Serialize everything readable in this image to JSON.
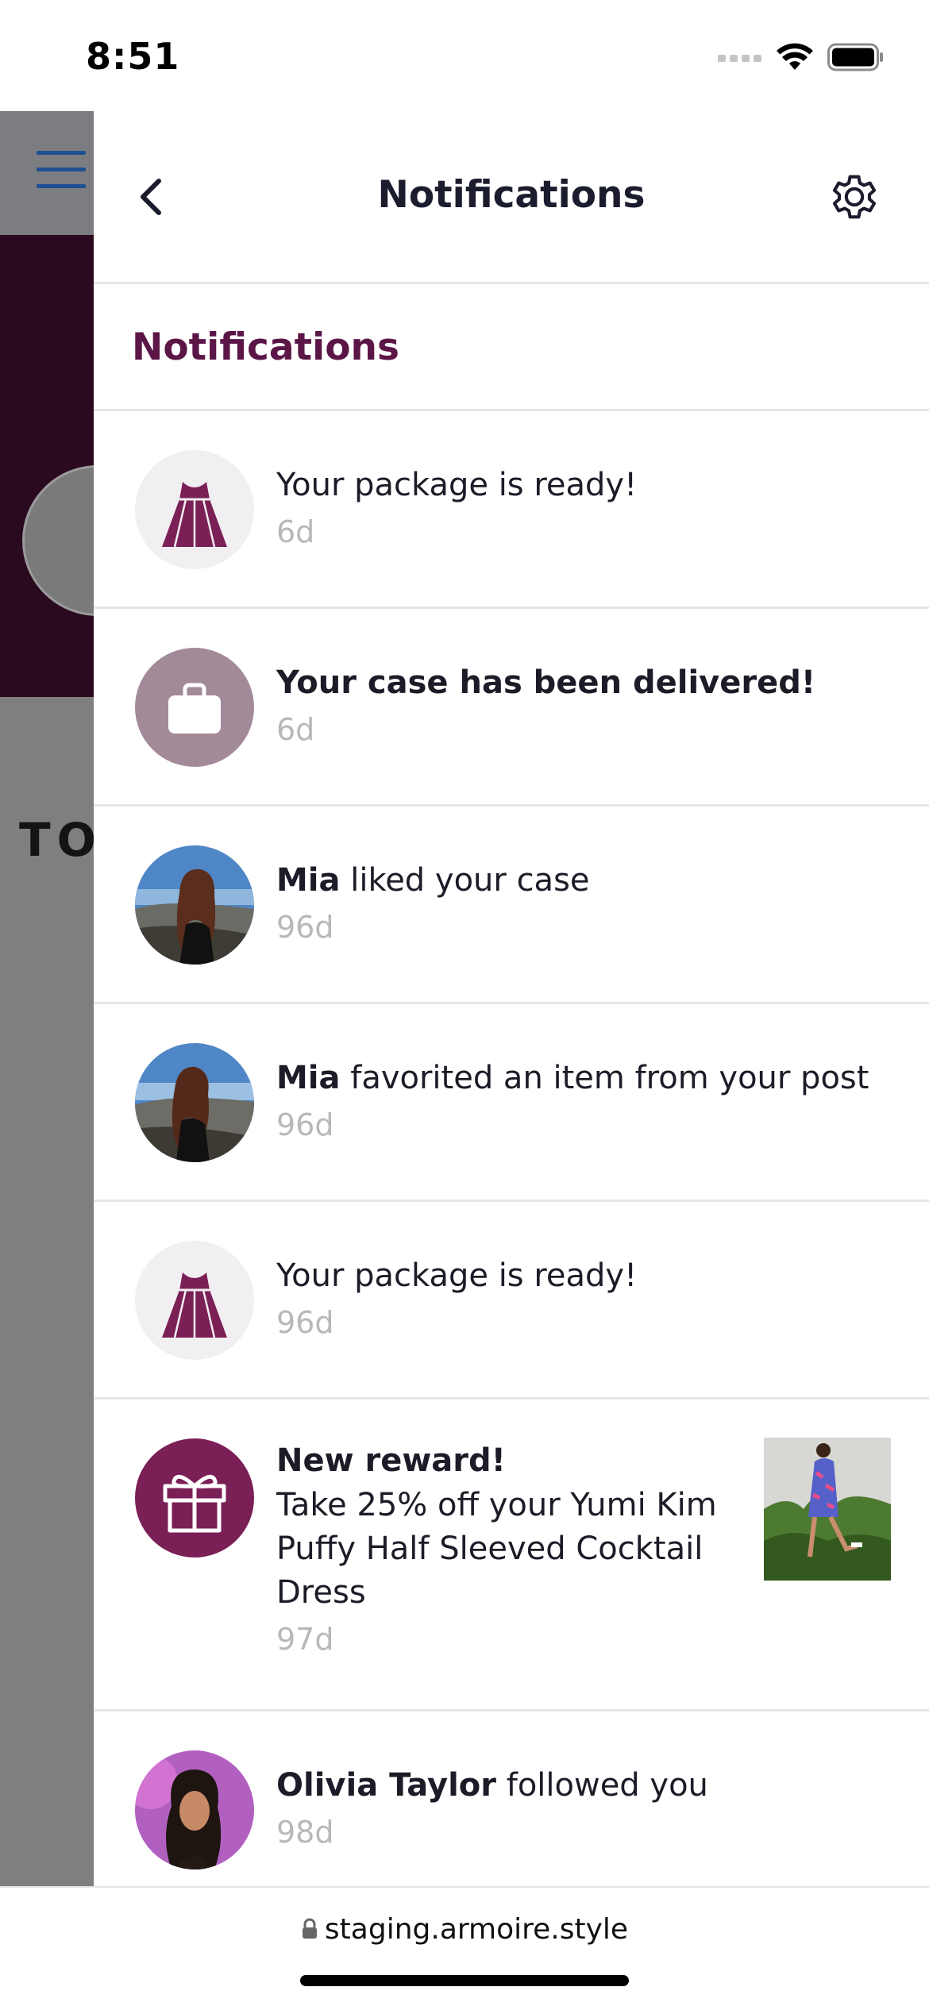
{
  "status_bar": {
    "time": "8:51"
  },
  "background_app": {
    "partial_text": "TO"
  },
  "header": {
    "title": "Notifications"
  },
  "section": {
    "title": "Notifications"
  },
  "notifications": [
    {
      "icon": "dress-icon",
      "actor": "",
      "text": "Your package is ready!",
      "time": "6d",
      "bold": false
    },
    {
      "icon": "briefcase-icon",
      "actor": "",
      "text": "Your case has been delivered!",
      "time": "6d",
      "bold": true
    },
    {
      "icon": "user-photo",
      "actor": "Mia",
      "text": " liked your case",
      "time": "96d"
    },
    {
      "icon": "user-photo",
      "actor": "Mia",
      "text": " favorited an item from your post",
      "time": "96d"
    },
    {
      "icon": "dress-icon",
      "actor": "",
      "text": "Your package is ready!",
      "time": "96d",
      "bold": false
    },
    {
      "icon": "gift-icon",
      "title": "New reward!",
      "text": "Take 25% off your Yumi Kim Puffy Half Sleeved Cocktail Dress",
      "time": "97d"
    },
    {
      "icon": "user-photo",
      "actor": "Olivia Taylor",
      "text": " followed you",
      "time": "98d"
    }
  ],
  "url_bar": {
    "url": "staging.armoire.style"
  },
  "colors": {
    "brand": "#7b1f57",
    "section_title": "#5b1647",
    "timestamp": "#b8b8b8",
    "divider": "#e6e6e6"
  }
}
